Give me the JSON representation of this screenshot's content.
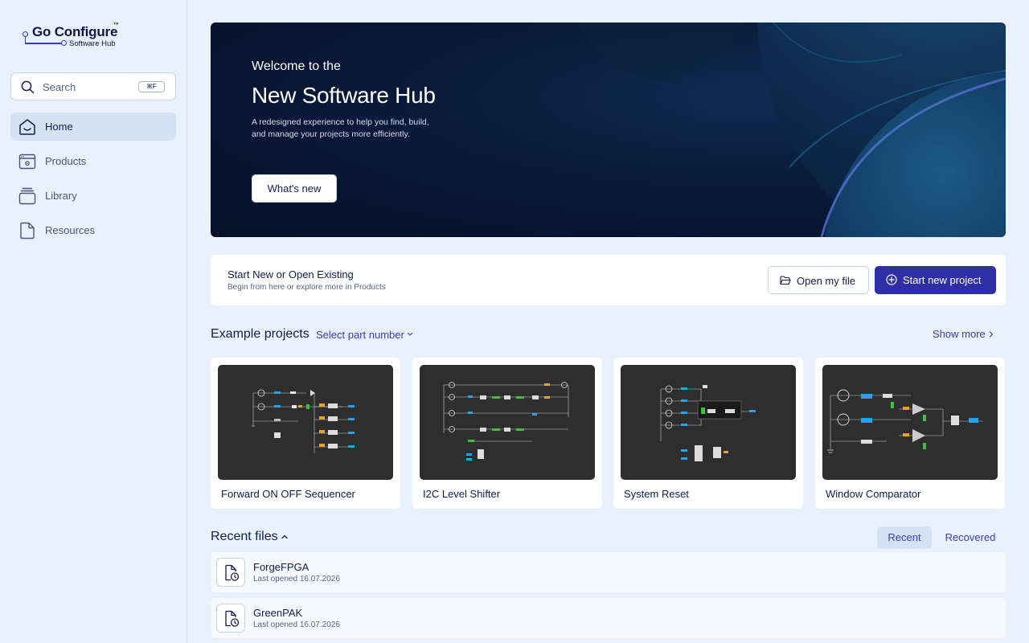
{
  "brand": {
    "name": "Go Configure",
    "trademark": "™",
    "subtitle": "Software Hub",
    "accent": "#2e3bd6"
  },
  "search": {
    "placeholder": "Search",
    "shortcut": "⌘F"
  },
  "sidebar": {
    "items": [
      {
        "label": "Home",
        "icon": "home-icon",
        "active": true
      },
      {
        "label": "Products",
        "icon": "products-icon",
        "active": false
      },
      {
        "label": "Library",
        "icon": "library-icon",
        "active": false
      },
      {
        "label": "Resources",
        "icon": "file-icon",
        "active": false
      }
    ]
  },
  "hero": {
    "pre_title": "Welcome to the",
    "title": "New Software Hub",
    "description": "A redesigned experience to help you find, build, and manage your projects more efficiently.",
    "button_label": "What's new"
  },
  "start": {
    "title": "Start New or Open Existing",
    "subtitle": "Begin from here or explore more in Products",
    "open_label": "Open my file",
    "new_label": "Start new project",
    "primary_color": "#2e2ea6"
  },
  "examples": {
    "title": "Example projects",
    "part_select": "Select part number",
    "show_more": "Show more",
    "cards": [
      {
        "label": "Forward ON OFF Sequencer"
      },
      {
        "label": "I2C Level Shifter"
      },
      {
        "label": "System Reset"
      },
      {
        "label": "Window Comparator"
      }
    ]
  },
  "recent": {
    "title": "Recent files",
    "tabs": [
      {
        "label": "Recent",
        "active": true
      },
      {
        "label": "Recovered",
        "active": false
      }
    ],
    "files": [
      {
        "name": "ForgeFPGA",
        "opened": "Last opened 16.07.2026"
      },
      {
        "name": "GreenPAK",
        "opened": "Last opened 16.07.2026"
      }
    ]
  }
}
